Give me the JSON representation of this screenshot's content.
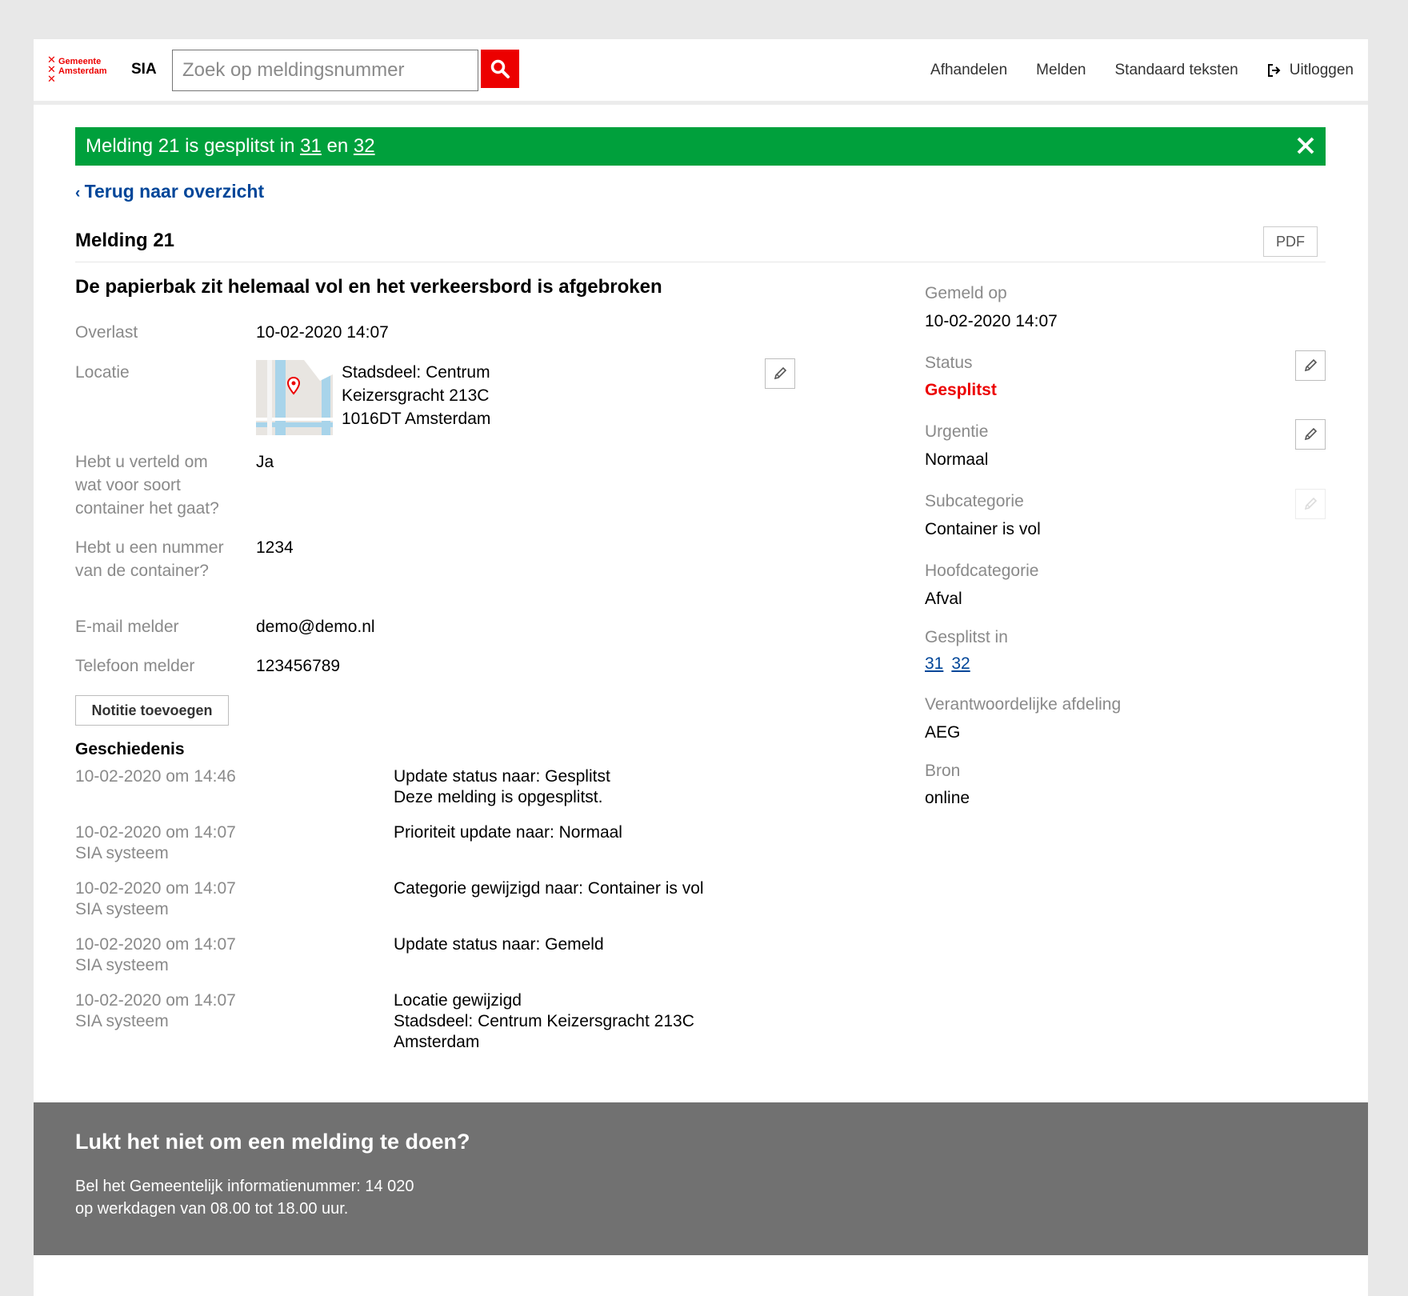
{
  "header": {
    "logo_text_line1": "Gemeente",
    "logo_text_line2": "Amsterdam",
    "app_name": "SIA",
    "search_placeholder": "Zoek op meldingsnummer",
    "nav": [
      "Afhandelen",
      "Melden",
      "Standaard teksten"
    ],
    "logout": "Uitloggen"
  },
  "notification": {
    "prefix": "Melding 21 is gesplitst in ",
    "link1": "31",
    "mid": " en ",
    "link2": "32",
    "color": "#00a03c"
  },
  "back_link": "Terug naar overzicht",
  "title": "Melding 21",
  "pdf_label": "PDF",
  "subject": "De papierbak zit helemaal vol en het verkeersbord is afgebroken",
  "details": {
    "overlast_label": "Overlast",
    "overlast_value": "10-02-2020 14:07",
    "locatie_label": "Locatie",
    "locatie_line1": "Stadsdeel: Centrum",
    "locatie_line2": "Keizersgracht 213C",
    "locatie_line3": "1016DT Amsterdam",
    "q1_label_1": "Hebt u verteld om",
    "q1_label_2": "wat voor soort",
    "q1_label_3": "container het gaat?",
    "q1_value": "Ja",
    "q2_label_1": "Hebt u een nummer",
    "q2_label_2": "van de container?",
    "q2_value": "1234",
    "email_label": "E-mail melder",
    "email_value": "demo@demo.nl",
    "phone_label": "Telefoon melder",
    "phone_value": "123456789"
  },
  "note_button": "Notitie toevoegen",
  "history": {
    "title": "Geschiedenis",
    "items": [
      {
        "when": "10-02-2020 om 14:46",
        "who": "",
        "what1": "Update status naar: Gesplitst",
        "what2": "Deze melding is opgesplitst.",
        "what3": ""
      },
      {
        "when": "10-02-2020 om 14:07",
        "who": "SIA systeem",
        "what1": "Prioriteit update naar: Normaal",
        "what2": "",
        "what3": ""
      },
      {
        "when": "10-02-2020 om 14:07",
        "who": "SIA systeem",
        "what1": "Categorie gewijzigd naar: Container is vol",
        "what2": "",
        "what3": ""
      },
      {
        "when": "10-02-2020 om 14:07",
        "who": "SIA systeem",
        "what1": "Update status naar: Gemeld",
        "what2": "",
        "what3": ""
      },
      {
        "when": "10-02-2020 om 14:07",
        "who": "SIA systeem",
        "what1": "Locatie gewijzigd",
        "what2": "Stadsdeel: Centrum Keizersgracht 213C",
        "what3": "Amsterdam"
      }
    ]
  },
  "meta": {
    "gemeld_label": "Gemeld op",
    "gemeld_value": "10-02-2020 14:07",
    "status_label": "Status",
    "status_value": "Gesplitst",
    "urgentie_label": "Urgentie",
    "urgentie_value": "Normaal",
    "subcat_label": "Subcategorie",
    "subcat_value": "Container is vol",
    "hoofdcat_label": "Hoofdcategorie",
    "hoofdcat_value": "Afval",
    "gesplitst_label": "Gesplitst in",
    "gesplitst_links": [
      "31",
      "32"
    ],
    "afdeling_label": "Verantwoordelijke afdeling",
    "afdeling_value": "AEG",
    "bron_label": "Bron",
    "bron_value": "online"
  },
  "footer": {
    "title": "Lukt het niet om een melding te doen?",
    "line1": "Bel het Gemeentelijk informatienummer: 14 020",
    "line2": "op werkdagen van 08.00 tot 18.00 uur."
  },
  "colors": {
    "brand_red": "#ec0000",
    "link_blue": "#004699",
    "footer_grey": "#717171"
  }
}
